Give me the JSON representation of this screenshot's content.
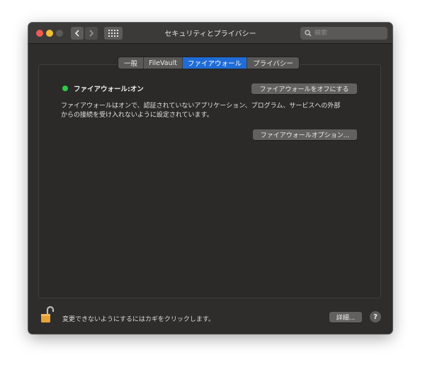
{
  "window": {
    "title": "セキュリティとプライバシー"
  },
  "toolbar": {
    "back_icon": "chevron-left-icon",
    "forward_icon": "chevron-right-icon",
    "grid_icon": "show-all-grid-icon"
  },
  "search": {
    "placeholder": "検索",
    "value": ""
  },
  "tabs": [
    {
      "label": "一般",
      "active": false
    },
    {
      "label": "FileVault",
      "active": false
    },
    {
      "label": "ファイアウォール",
      "active": true
    },
    {
      "label": "プライバシー",
      "active": false
    }
  ],
  "firewall": {
    "status_label": "ファイアウォール:オン",
    "status_color": "#2ec84a",
    "turn_off_button": "ファイアウォールをオフにする",
    "description_line1": "ファイアウォールはオンで、認証されていないアプリケーション、プログラム、サービスへの外部",
    "description_line2": "からの接続を受け入れないように設定されています。",
    "options_button": "ファイアウォールオプション..."
  },
  "footer": {
    "lock_text": "変更できないようにするにはカギをクリックします。",
    "details_button": "詳細...",
    "help_label": "?"
  },
  "colors": {
    "accent": "#1f6cd7",
    "window_bg": "#2e2d2c",
    "close": "#ee5b54",
    "minimize": "#f1bd32",
    "lock": "#e7a23a"
  }
}
